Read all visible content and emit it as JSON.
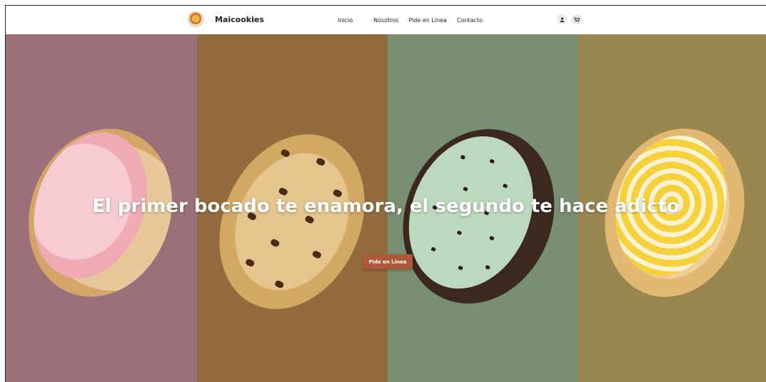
{
  "header": {
    "brand": "Maicookies",
    "nav": [
      "Inicio",
      "Nosotros",
      "Pide en Línea",
      "Contacto"
    ],
    "icons": [
      "user-icon",
      "cart-icon"
    ]
  },
  "hero": {
    "headline": "El primer bocado te enamora, el segundo te hace adicto",
    "cta_label": "Pide en Línea",
    "panel_colors": [
      "#9c707b",
      "#926c3c",
      "#788f72",
      "#9a864f"
    ],
    "cta_color": "#b0583a"
  }
}
